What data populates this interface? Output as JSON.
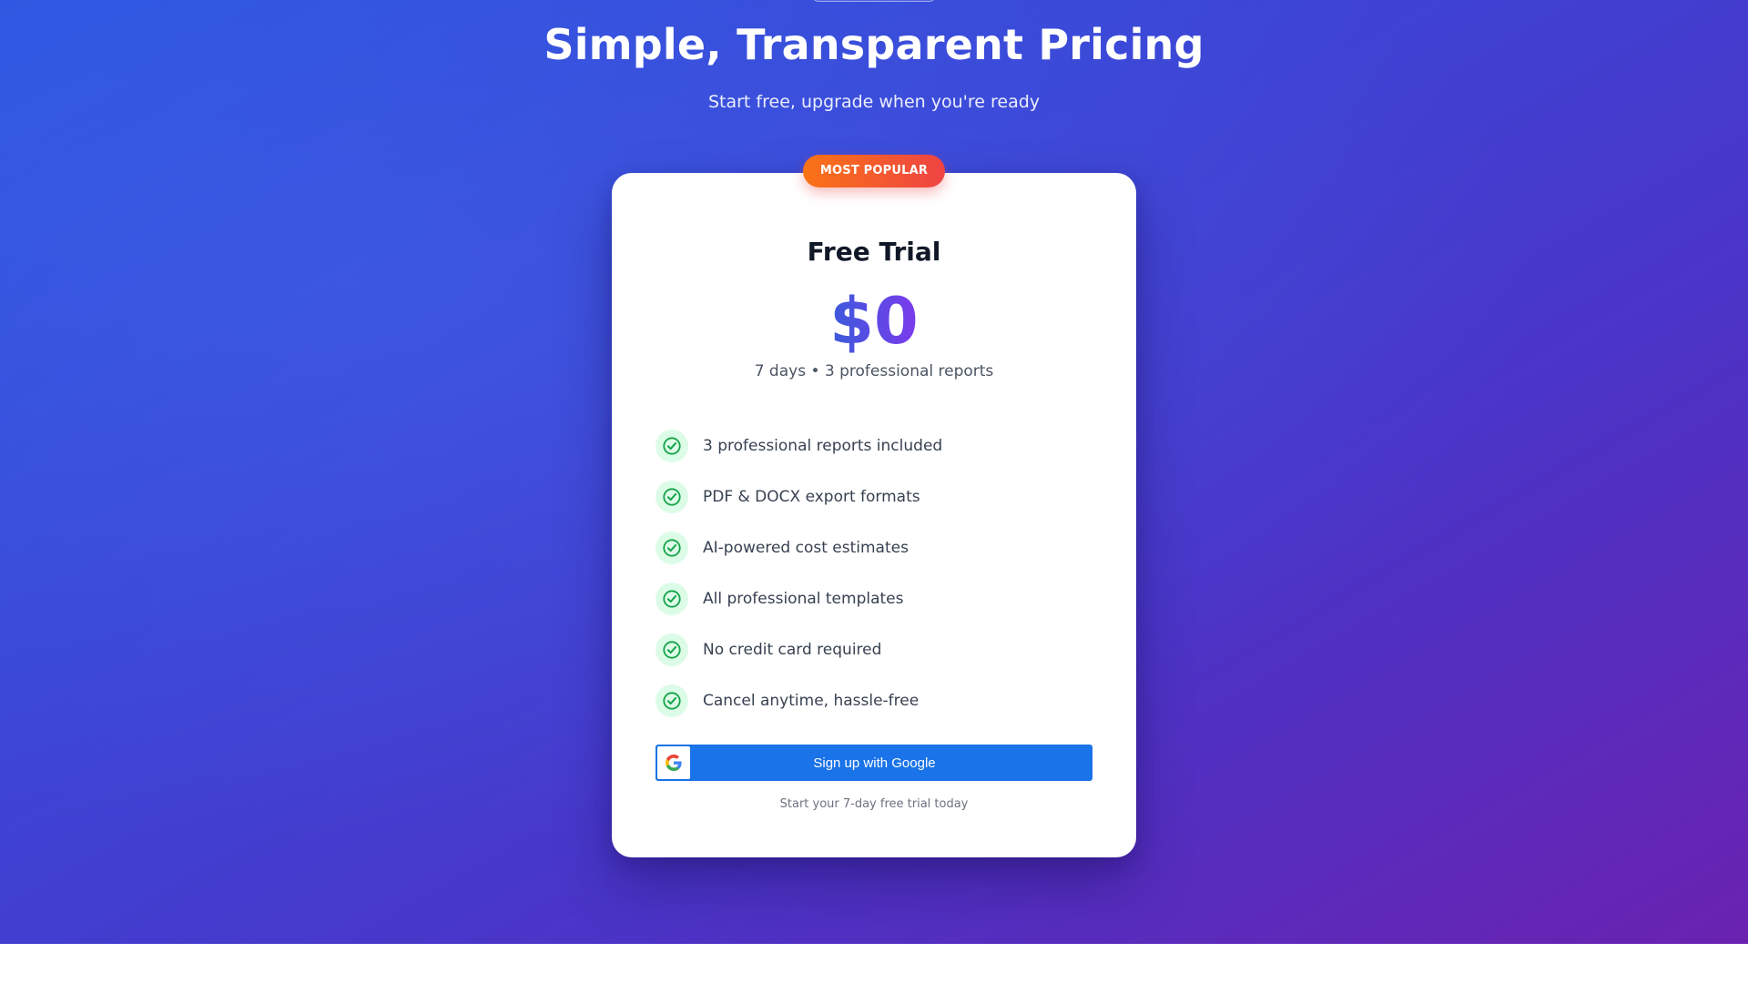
{
  "hero": {
    "title": "Simple, Transparent Pricing",
    "subtitle": "Start free, upgrade when you're ready"
  },
  "plan": {
    "badge": "MOST POPULAR",
    "name": "Free Trial",
    "price": "$0",
    "price_sub": "7 days • 3 professional reports",
    "features": [
      "3 professional reports included",
      "PDF & DOCX export formats",
      "AI-powered cost estimates",
      "All professional templates",
      "No credit card required",
      "Cancel anytime, hassle-free"
    ],
    "signup_label": "Sign up with Google",
    "note": "Start your 7-day free trial today"
  },
  "colors": {
    "hero_start": "#2b55e0",
    "hero_end": "#6a22b0",
    "badge_start": "#f97316",
    "badge_end": "#ef4444",
    "price_start": "#3b5bdb",
    "price_end": "#7c3aed",
    "check": "#16a34a",
    "google_blue": "#1a73e8"
  },
  "icons": {
    "feature": "check-circle-icon",
    "signup": "google-icon"
  }
}
